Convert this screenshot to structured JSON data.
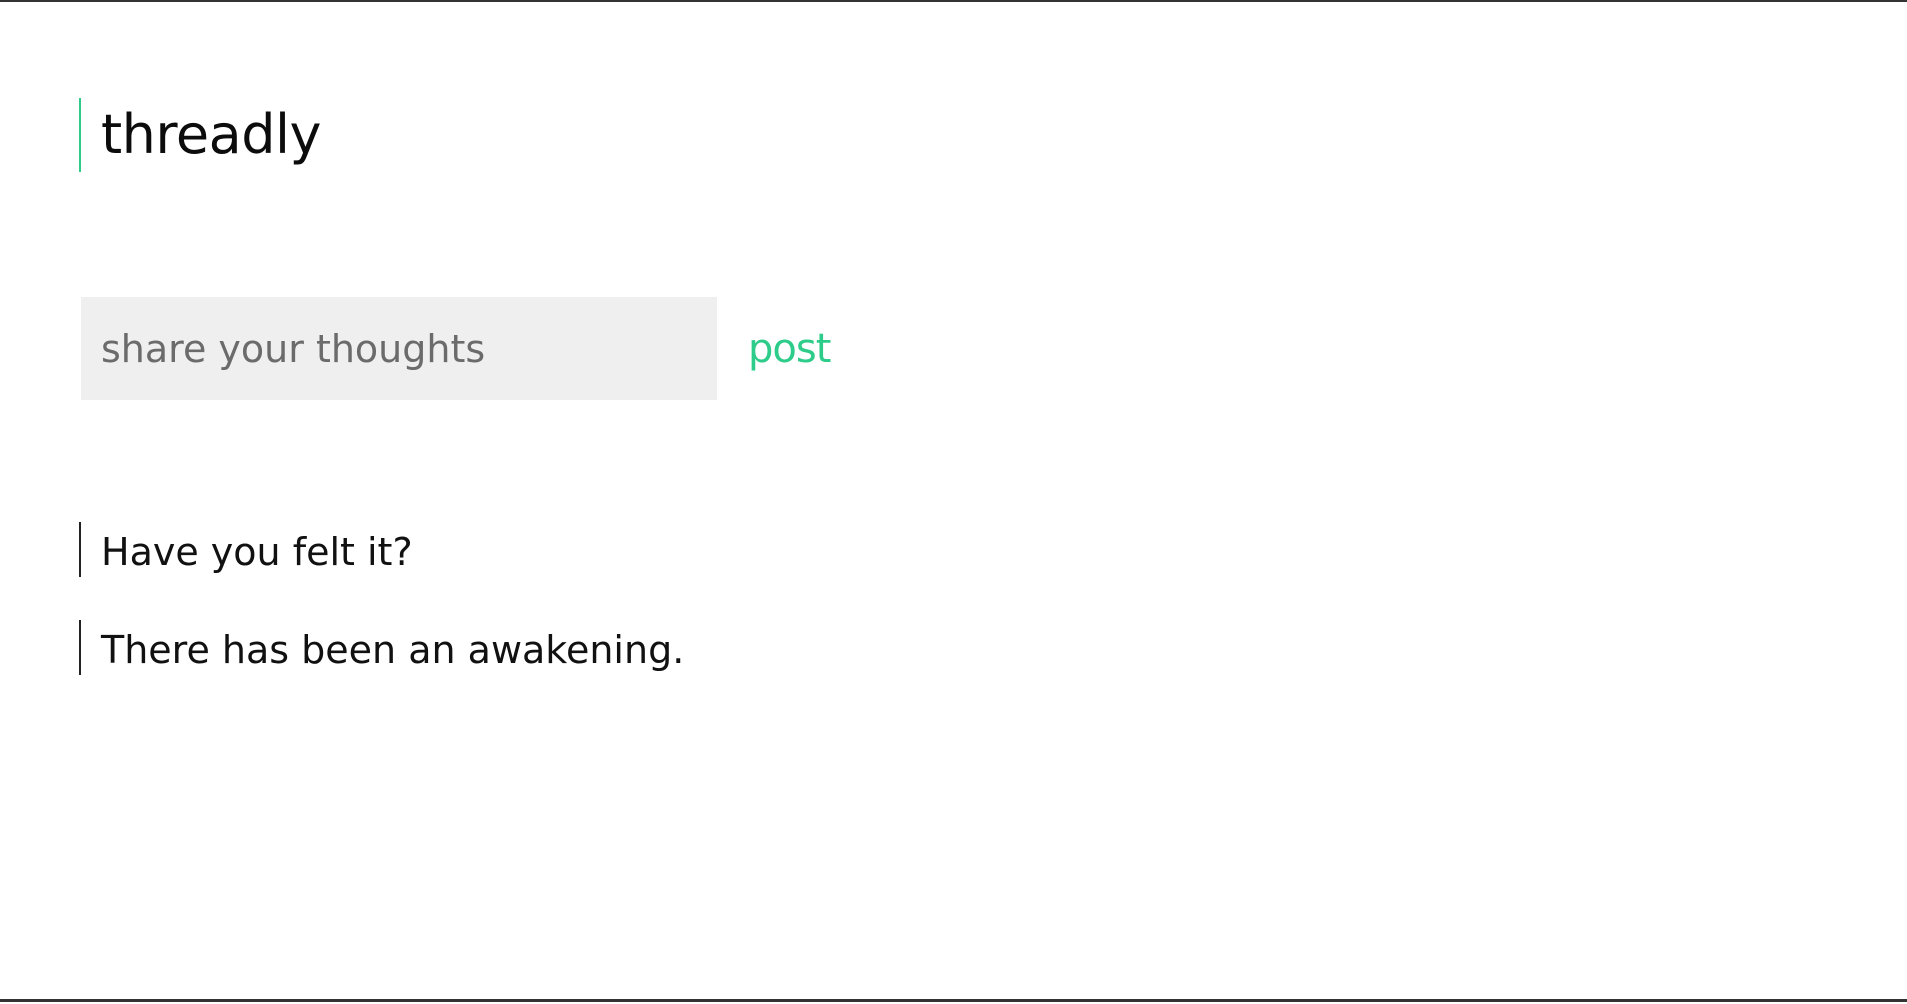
{
  "app": {
    "title": "threadly",
    "accent_color": "#2ecc8a"
  },
  "composer": {
    "placeholder": "share your thoughts",
    "value": "",
    "post_label": "post"
  },
  "feed": {
    "thoughts": [
      {
        "text": "Have you felt it?"
      },
      {
        "text": "There has been an awakening."
      }
    ]
  }
}
